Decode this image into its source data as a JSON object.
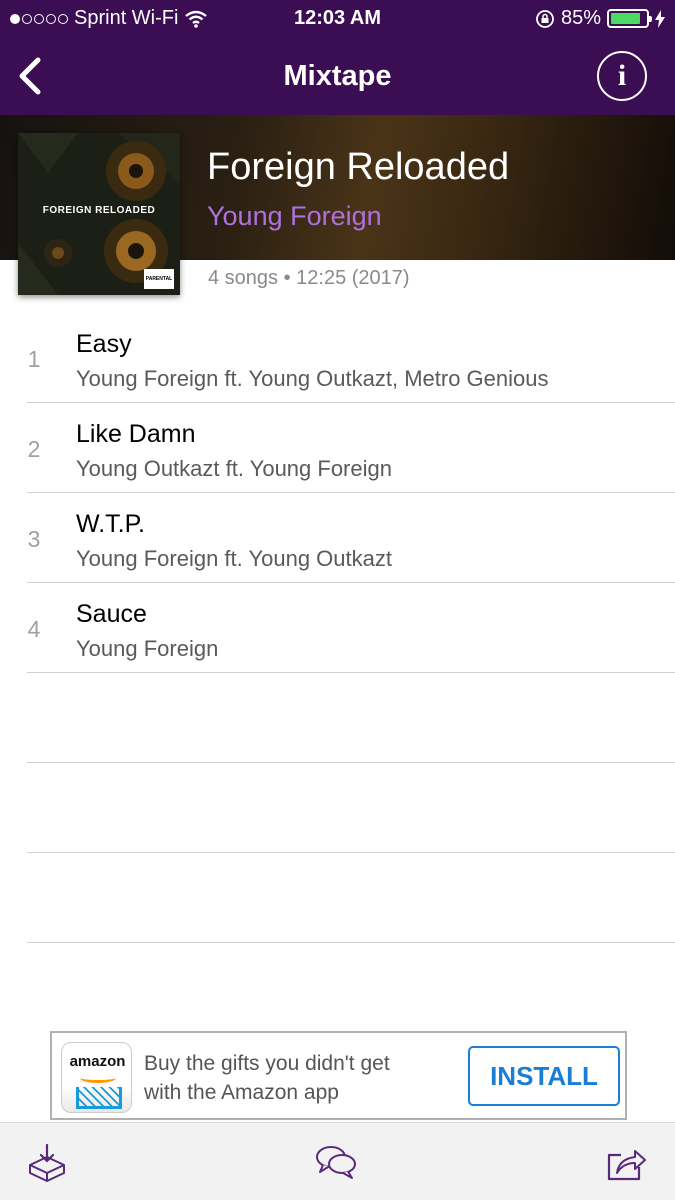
{
  "status_bar": {
    "carrier": "Sprint Wi-Fi",
    "time": "12:03 AM",
    "battery_percent": "85%",
    "battery_level": 0.85,
    "signal_bars_filled": 1,
    "signal_bars_total": 5,
    "icons": [
      "wifi-icon",
      "orientation-lock-icon",
      "battery-icon",
      "charging-bolt-icon"
    ]
  },
  "nav": {
    "title": "Mixtape",
    "back_icon": "chevron-left-icon",
    "info_label": "i"
  },
  "album": {
    "cover_title": "FOREIGN RELOADED",
    "cover_advisory": "PARENTAL ADVISORY",
    "title": "Foreign Reloaded",
    "artist": "Young Foreign",
    "meta": "4 songs • 12:25 (2017)"
  },
  "tracks": [
    {
      "number": "1",
      "name": "Easy",
      "artist": "Young Foreign ft. Young Outkazt, Metro Genious"
    },
    {
      "number": "2",
      "name": "Like Damn",
      "artist": "Young Outkazt ft. Young Foreign"
    },
    {
      "number": "3",
      "name": "W.T.P.",
      "artist": "Young Foreign ft. Young Outkazt"
    },
    {
      "number": "4",
      "name": "Sauce",
      "artist": "Young Foreign"
    }
  ],
  "ad": {
    "logo_text": "amazon",
    "text": "Buy the gifts you didn't get with the Amazon app",
    "button_label": "INSTALL"
  },
  "tab_bar": {
    "items": [
      "download-icon",
      "chat-bubbles-icon",
      "share-icon"
    ]
  },
  "colors": {
    "bar_purple": "#3b0d52",
    "artist_purple": "#b070e0",
    "install_blue": "#1a7fd4",
    "icon_purple": "#5a2a7a"
  }
}
